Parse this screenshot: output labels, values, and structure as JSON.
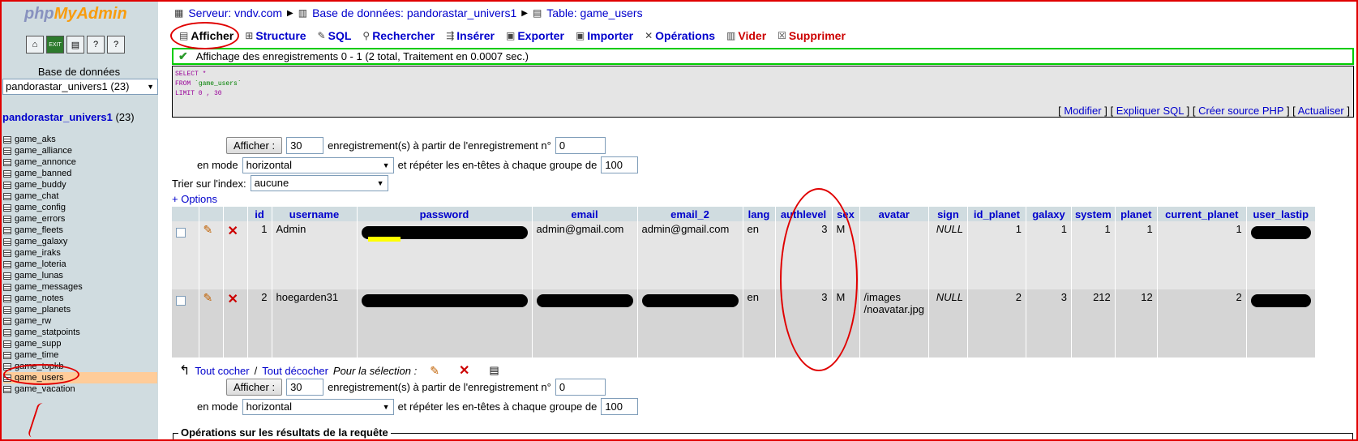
{
  "sidebar": {
    "logo_php": "php",
    "logo_my": "MyAdmin",
    "db_label": "Base de données",
    "db_select": "pandorastar_univers1 (23)",
    "db_name": "pandorastar_univers1",
    "db_count": "(23)",
    "tables": [
      "game_aks",
      "game_alliance",
      "game_annonce",
      "game_banned",
      "game_buddy",
      "game_chat",
      "game_config",
      "game_errors",
      "game_fleets",
      "game_galaxy",
      "game_iraks",
      "game_loteria",
      "game_lunas",
      "game_messages",
      "game_notes",
      "game_planets",
      "game_rw",
      "game_statpoints",
      "game_supp",
      "game_time",
      "game_topkb",
      "game_users",
      "game_vacation"
    ],
    "active_table": "game_users"
  },
  "breadcrumb": {
    "server": "Serveur: vndv.com",
    "database": "Base de données: pandorastar_univers1",
    "table": "Table: game_users"
  },
  "tabs": [
    "Afficher",
    "Structure",
    "SQL",
    "Rechercher",
    "Insérer",
    "Exporter",
    "Importer",
    "Opérations",
    "Vider",
    "Supprimer"
  ],
  "status_message": "Affichage des enregistrements 0 - 1 (2 total, Traitement en 0.0007 sec.)",
  "sql": {
    "select": "SELECT *",
    "from_kw": "FROM",
    "from_table": "`game_users`",
    "limit": "LIMIT 0 , 30"
  },
  "sql_links": [
    "Modifier",
    "Expliquer SQL",
    "Créer source PHP",
    "Actualiser"
  ],
  "controls": {
    "show_button": "Afficher :",
    "rows_value": "30",
    "records_text": "enregistrement(s) à partir de l'enregistrement n°",
    "start_value": "0",
    "mode_label": "en mode",
    "mode_value": "horizontal",
    "repeat_text": "et répéter les en-têtes à chaque groupe de",
    "repeat_value": "100",
    "sort_label": "Trier sur l'index:",
    "sort_value": "aucune",
    "options_link": "+ Options"
  },
  "table": {
    "columns": [
      "id",
      "username",
      "password",
      "email",
      "email_2",
      "lang",
      "authlevel",
      "sex",
      "avatar",
      "sign",
      "id_planet",
      "galaxy",
      "system",
      "planet",
      "current_planet",
      "user_lastip"
    ],
    "rows": [
      {
        "id": "1",
        "username": "Admin",
        "email": "admin@gmail.com",
        "email_2": "admin@gmail.com",
        "lang": "en",
        "authlevel": "3",
        "sex": "M",
        "avatar": "",
        "sign": "NULL",
        "id_planet": "1",
        "galaxy": "1",
        "system": "1",
        "planet": "1",
        "current_planet": "1"
      },
      {
        "id": "2",
        "username": "hoegarden31",
        "email": "",
        "email_2": "",
        "lang": "en",
        "authlevel": "3",
        "sex": "M",
        "avatar": "/images\n/noavatar.jpg",
        "sign": "NULL",
        "id_planet": "2",
        "galaxy": "3",
        "system": "212",
        "planet": "12",
        "current_planet": "2"
      }
    ]
  },
  "selection": {
    "check_all": "Tout cocher",
    "slash": "/",
    "uncheck_all": "Tout décocher",
    "for_selection": "Pour la sélection :"
  },
  "operations_legend": "Opérations sur les résultats de la requête",
  "colors": {
    "link": "#0000cc",
    "sidebar_bg": "#d0dce0",
    "annotation": "#e00000",
    "ok_border": "#00cc00"
  }
}
